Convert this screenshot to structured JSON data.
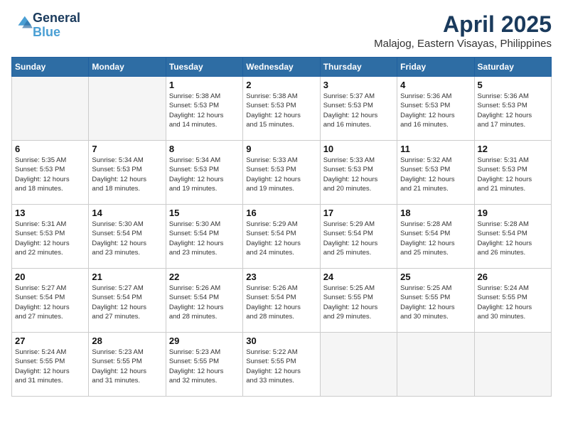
{
  "header": {
    "logo_line1": "General",
    "logo_line2": "Blue",
    "title": "April 2025",
    "subtitle": "Malajog, Eastern Visayas, Philippines"
  },
  "weekdays": [
    "Sunday",
    "Monday",
    "Tuesday",
    "Wednesday",
    "Thursday",
    "Friday",
    "Saturday"
  ],
  "weeks": [
    [
      {
        "day": "",
        "empty": true
      },
      {
        "day": "",
        "empty": true
      },
      {
        "day": "1",
        "sunrise": "5:38 AM",
        "sunset": "5:53 PM",
        "daylight": "12 hours and 14 minutes."
      },
      {
        "day": "2",
        "sunrise": "5:38 AM",
        "sunset": "5:53 PM",
        "daylight": "12 hours and 15 minutes."
      },
      {
        "day": "3",
        "sunrise": "5:37 AM",
        "sunset": "5:53 PM",
        "daylight": "12 hours and 16 minutes."
      },
      {
        "day": "4",
        "sunrise": "5:36 AM",
        "sunset": "5:53 PM",
        "daylight": "12 hours and 16 minutes."
      },
      {
        "day": "5",
        "sunrise": "5:36 AM",
        "sunset": "5:53 PM",
        "daylight": "12 hours and 17 minutes."
      }
    ],
    [
      {
        "day": "6",
        "sunrise": "5:35 AM",
        "sunset": "5:53 PM",
        "daylight": "12 hours and 18 minutes."
      },
      {
        "day": "7",
        "sunrise": "5:34 AM",
        "sunset": "5:53 PM",
        "daylight": "12 hours and 18 minutes."
      },
      {
        "day": "8",
        "sunrise": "5:34 AM",
        "sunset": "5:53 PM",
        "daylight": "12 hours and 19 minutes."
      },
      {
        "day": "9",
        "sunrise": "5:33 AM",
        "sunset": "5:53 PM",
        "daylight": "12 hours and 19 minutes."
      },
      {
        "day": "10",
        "sunrise": "5:33 AM",
        "sunset": "5:53 PM",
        "daylight": "12 hours and 20 minutes."
      },
      {
        "day": "11",
        "sunrise": "5:32 AM",
        "sunset": "5:53 PM",
        "daylight": "12 hours and 21 minutes."
      },
      {
        "day": "12",
        "sunrise": "5:31 AM",
        "sunset": "5:53 PM",
        "daylight": "12 hours and 21 minutes."
      }
    ],
    [
      {
        "day": "13",
        "sunrise": "5:31 AM",
        "sunset": "5:53 PM",
        "daylight": "12 hours and 22 minutes."
      },
      {
        "day": "14",
        "sunrise": "5:30 AM",
        "sunset": "5:54 PM",
        "daylight": "12 hours and 23 minutes."
      },
      {
        "day": "15",
        "sunrise": "5:30 AM",
        "sunset": "5:54 PM",
        "daylight": "12 hours and 23 minutes."
      },
      {
        "day": "16",
        "sunrise": "5:29 AM",
        "sunset": "5:54 PM",
        "daylight": "12 hours and 24 minutes."
      },
      {
        "day": "17",
        "sunrise": "5:29 AM",
        "sunset": "5:54 PM",
        "daylight": "12 hours and 25 minutes."
      },
      {
        "day": "18",
        "sunrise": "5:28 AM",
        "sunset": "5:54 PM",
        "daylight": "12 hours and 25 minutes."
      },
      {
        "day": "19",
        "sunrise": "5:28 AM",
        "sunset": "5:54 PM",
        "daylight": "12 hours and 26 minutes."
      }
    ],
    [
      {
        "day": "20",
        "sunrise": "5:27 AM",
        "sunset": "5:54 PM",
        "daylight": "12 hours and 27 minutes."
      },
      {
        "day": "21",
        "sunrise": "5:27 AM",
        "sunset": "5:54 PM",
        "daylight": "12 hours and 27 minutes."
      },
      {
        "day": "22",
        "sunrise": "5:26 AM",
        "sunset": "5:54 PM",
        "daylight": "12 hours and 28 minutes."
      },
      {
        "day": "23",
        "sunrise": "5:26 AM",
        "sunset": "5:54 PM",
        "daylight": "12 hours and 28 minutes."
      },
      {
        "day": "24",
        "sunrise": "5:25 AM",
        "sunset": "5:55 PM",
        "daylight": "12 hours and 29 minutes."
      },
      {
        "day": "25",
        "sunrise": "5:25 AM",
        "sunset": "5:55 PM",
        "daylight": "12 hours and 30 minutes."
      },
      {
        "day": "26",
        "sunrise": "5:24 AM",
        "sunset": "5:55 PM",
        "daylight": "12 hours and 30 minutes."
      }
    ],
    [
      {
        "day": "27",
        "sunrise": "5:24 AM",
        "sunset": "5:55 PM",
        "daylight": "12 hours and 31 minutes."
      },
      {
        "day": "28",
        "sunrise": "5:23 AM",
        "sunset": "5:55 PM",
        "daylight": "12 hours and 31 minutes."
      },
      {
        "day": "29",
        "sunrise": "5:23 AM",
        "sunset": "5:55 PM",
        "daylight": "12 hours and 32 minutes."
      },
      {
        "day": "30",
        "sunrise": "5:22 AM",
        "sunset": "5:55 PM",
        "daylight": "12 hours and 33 minutes."
      },
      {
        "day": "",
        "empty": true
      },
      {
        "day": "",
        "empty": true
      },
      {
        "day": "",
        "empty": true
      }
    ]
  ],
  "labels": {
    "sunrise": "Sunrise:",
    "sunset": "Sunset:",
    "daylight": "Daylight:"
  }
}
